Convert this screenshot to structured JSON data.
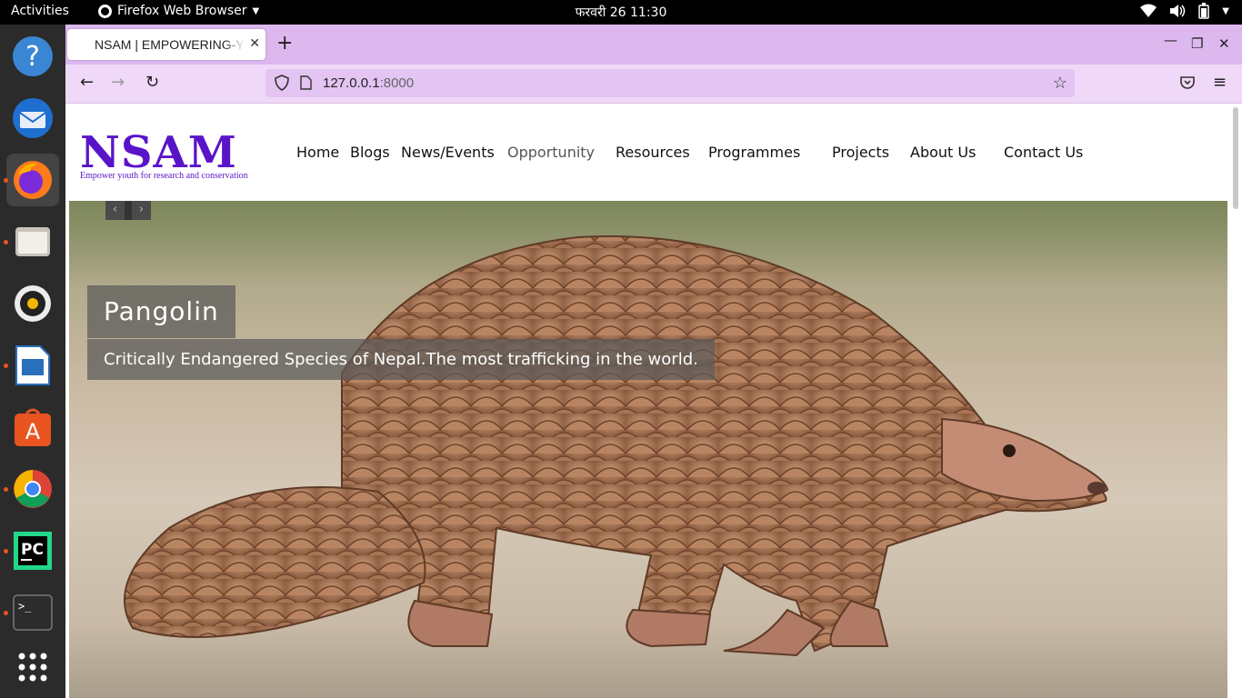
{
  "topbar": {
    "activities": "Activities",
    "app_name": "Firefox Web Browser",
    "clock": "फरवरी 26  11:30",
    "icons": [
      "wifi-icon",
      "volume-icon",
      "battery-icon",
      "chevron-down-icon"
    ]
  },
  "dock": {
    "items": [
      "help-icon",
      "thunderbird-icon",
      "firefox-icon",
      "files-icon",
      "rhythmbox-icon",
      "libreoffice-impress-icon",
      "app-center-icon",
      "chrome-icon",
      "pycharm-icon",
      "terminal-icon",
      "show-apps-icon"
    ]
  },
  "browser": {
    "tab_title": "NSAM | EMPOWERING-YOUTH",
    "url_host": "127.0.0.1",
    "url_port": ":8000"
  },
  "site": {
    "logo": "NSAM",
    "tagline": "Empower youth for research and conservation",
    "menu": [
      "Home",
      "Blogs",
      "News/Events",
      "Opportunity",
      "Resources",
      "Programmes",
      "Projects",
      "About Us",
      "Contact Us"
    ]
  },
  "hero": {
    "title": "Pangolin",
    "text": "Critically Endangered Species of Nepal.The most trafficking in the world."
  },
  "colors": {
    "brand": "#5a14c8",
    "tab_strip": "#dcb8ef",
    "toolbar": "#f0d8f8"
  }
}
